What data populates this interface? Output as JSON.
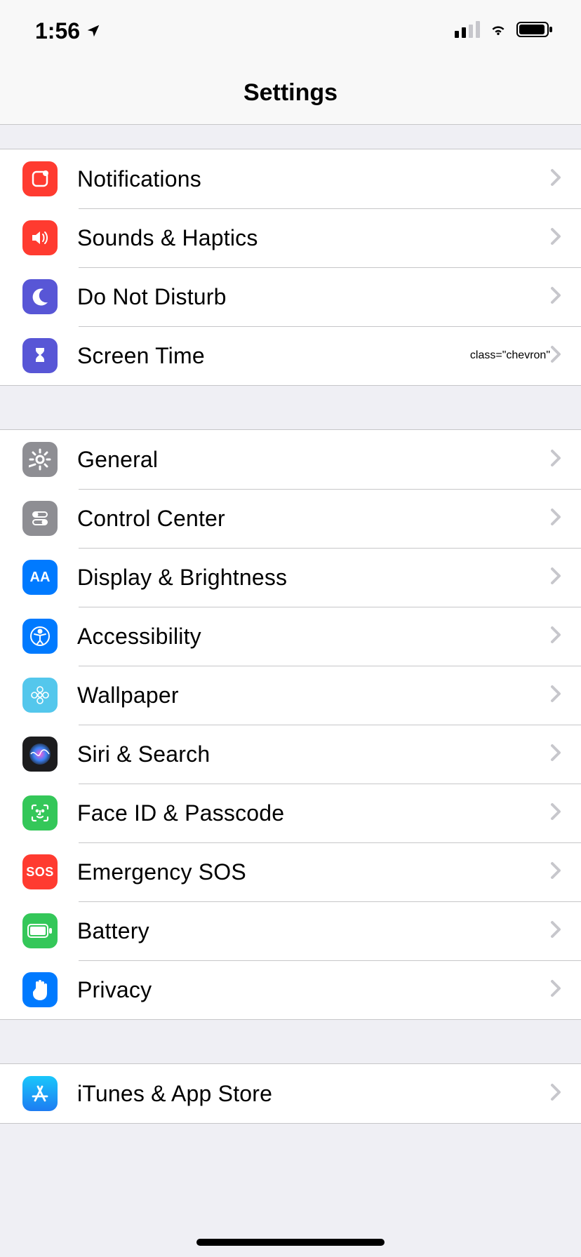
{
  "status": {
    "time": "1:56"
  },
  "header": {
    "title": "Settings"
  },
  "groups": [
    {
      "rows": [
        {
          "label": "Notifications",
          "icon": "notifications-icon",
          "bg": "bg-red"
        },
        {
          "label": "Sounds & Haptics",
          "icon": "sound-icon",
          "bg": "bg-red"
        },
        {
          "label": "Do Not Disturb",
          "icon": "moon-icon",
          "bg": "bg-purple"
        },
        {
          "label": "Screen Time",
          "icon": "hourglass-icon",
          "bg": "bg-purple"
        }
      ]
    },
    {
      "rows": [
        {
          "label": "General",
          "icon": "gear-icon",
          "bg": "bg-gray"
        },
        {
          "label": "Control Center",
          "icon": "toggles-icon",
          "bg": "bg-gray"
        },
        {
          "label": "Display & Brightness",
          "icon": "text-size-icon",
          "bg": "bg-blue"
        },
        {
          "label": "Accessibility",
          "icon": "accessibility-icon",
          "bg": "bg-blue"
        },
        {
          "label": "Wallpaper",
          "icon": "flower-icon",
          "bg": "bg-cyan"
        },
        {
          "label": "Siri & Search",
          "icon": "siri-icon",
          "bg": "bg-dark"
        },
        {
          "label": "Face ID & Passcode",
          "icon": "faceid-icon",
          "bg": "bg-green"
        },
        {
          "label": "Emergency SOS",
          "icon": "sos-icon",
          "bg": "bg-red"
        },
        {
          "label": "Battery",
          "icon": "battery-icon",
          "bg": "bg-green"
        },
        {
          "label": "Privacy",
          "icon": "hand-icon",
          "bg": "bg-blue"
        }
      ]
    },
    {
      "rows": [
        {
          "label": "iTunes & App Store",
          "icon": "appstore-icon",
          "bg": "bg-appstore"
        }
      ]
    }
  ]
}
